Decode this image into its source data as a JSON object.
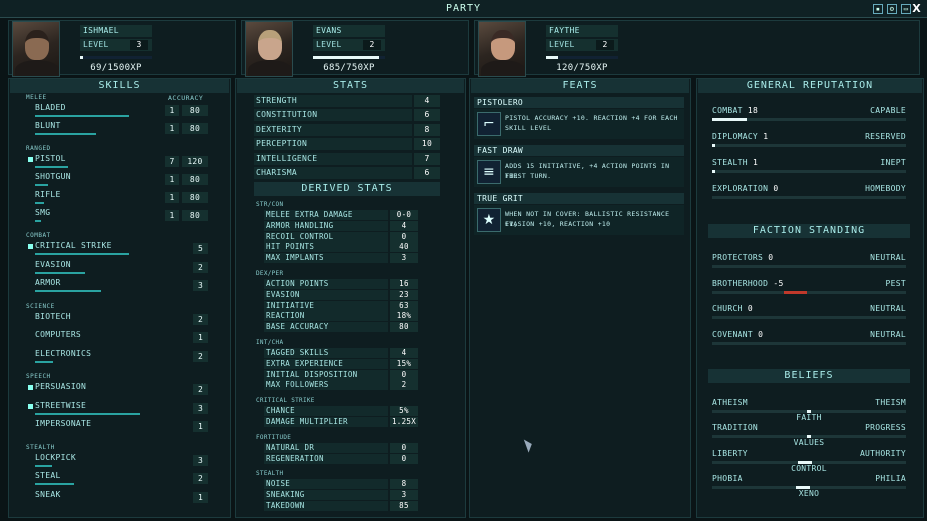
{
  "window": {
    "title": "PARTY",
    "close": "X"
  },
  "party": [
    {
      "name": "ISHMAEL",
      "level_label": "LEVEL",
      "level": "3",
      "xp": "69/1500XP",
      "xp_progress": 0.046,
      "skin": "#8a6a52",
      "hair": "#2a211c"
    },
    {
      "name": "EVANS",
      "level_label": "LEVEL",
      "level": "2",
      "xp": "685/750XP",
      "xp_progress": 0.913,
      "skin": "#c9a58c",
      "hair": "#b8a07a"
    },
    {
      "name": "FAYTHE",
      "level_label": "LEVEL",
      "level": "2",
      "xp": "120/750XP",
      "xp_progress": 0.16,
      "skin": "#c6997d",
      "hair": "#3a2a25"
    }
  ],
  "skills": {
    "title": "SKILLS",
    "accuracy_label": "ACCURACY",
    "sections": [
      {
        "name": "MELEE",
        "items": [
          {
            "name": "BLADED",
            "value": "1",
            "accuracy": "80",
            "bar": 0.85,
            "tag": false
          },
          {
            "name": "BLUNT",
            "value": "1",
            "accuracy": "80",
            "bar": 0.55,
            "tag": false
          }
        ]
      },
      {
        "name": "RANGED",
        "items": [
          {
            "name": "PISTOL",
            "value": "7",
            "accuracy": "120",
            "bar": 0.3,
            "tag": true
          },
          {
            "name": "SHOTGUN",
            "value": "1",
            "accuracy": "80",
            "bar": 0.12,
            "tag": false
          },
          {
            "name": "RIFLE",
            "value": "1",
            "accuracy": "80",
            "bar": 0.08,
            "tag": false
          },
          {
            "name": "SMG",
            "value": "1",
            "accuracy": "80",
            "bar": 0.05,
            "tag": false
          }
        ]
      },
      {
        "name": "COMBAT",
        "items": [
          {
            "name": "CRITICAL STRIKE",
            "value": "5",
            "bar": 0.85,
            "tag": true
          },
          {
            "name": "EVASION",
            "value": "2",
            "bar": 0.45,
            "tag": false
          },
          {
            "name": "ARMOR",
            "value": "3",
            "bar": 0.6,
            "tag": false
          }
        ]
      },
      {
        "name": "SCIENCE",
        "items": [
          {
            "name": "BIOTECH",
            "value": "2",
            "bar": 0.0,
            "tag": false
          },
          {
            "name": "COMPUTERS",
            "value": "1",
            "bar": 0.0,
            "tag": false
          },
          {
            "name": "ELECTRONICS",
            "value": "2",
            "bar": 0.16,
            "tag": false
          }
        ]
      },
      {
        "name": "SPEECH",
        "items": [
          {
            "name": "PERSUASION",
            "value": "2",
            "bar": 0.0,
            "tag": true
          },
          {
            "name": "STREETWISE",
            "value": "3",
            "bar": 0.95,
            "tag": true
          },
          {
            "name": "IMPERSONATE",
            "value": "1",
            "bar": 0.0,
            "tag": false
          }
        ]
      },
      {
        "name": "STEALTH",
        "items": [
          {
            "name": "LOCKPICK",
            "value": "3",
            "bar": 0.15,
            "tag": false
          },
          {
            "name": "STEAL",
            "value": "2",
            "bar": 0.35,
            "tag": false
          },
          {
            "name": "SNEAK",
            "value": "1",
            "bar": 0.0,
            "tag": false
          }
        ]
      }
    ]
  },
  "stats": {
    "title": "STATS",
    "items": [
      {
        "name": "STRENGTH",
        "value": "4"
      },
      {
        "name": "CONSTITUTION",
        "value": "6"
      },
      {
        "name": "DEXTERITY",
        "value": "8"
      },
      {
        "name": "PERCEPTION",
        "value": "10"
      },
      {
        "name": "INTELLIGENCE",
        "value": "7"
      },
      {
        "name": "CHARISMA",
        "value": "6"
      }
    ]
  },
  "derived": {
    "title": "DERIVED STATS",
    "sections": [
      {
        "name": "STR/CON",
        "items": [
          {
            "name": "MELEE EXTRA DAMAGE",
            "value": "0-0"
          },
          {
            "name": "ARMOR HANDLING",
            "value": "4"
          },
          {
            "name": "RECOIL CONTROL",
            "value": "0"
          },
          {
            "name": "HIT POINTS",
            "value": "40"
          },
          {
            "name": "MAX IMPLANTS",
            "value": "3"
          }
        ]
      },
      {
        "name": "DEX/PER",
        "items": [
          {
            "name": "ACTION POINTS",
            "value": "16"
          },
          {
            "name": "EVASION",
            "value": "23"
          },
          {
            "name": "INITIATIVE",
            "value": "63"
          },
          {
            "name": "REACTION",
            "value": "18%"
          },
          {
            "name": "BASE ACCURACY",
            "value": "80"
          }
        ]
      },
      {
        "name": "INT/CHA",
        "items": [
          {
            "name": "TAGGED SKILLS",
            "value": "4"
          },
          {
            "name": "EXTRA EXPERIENCE",
            "value": "15%"
          },
          {
            "name": "INITIAL DISPOSITION",
            "value": "0"
          },
          {
            "name": "MAX FOLLOWERS",
            "value": "2"
          }
        ]
      },
      {
        "name": "CRITICAL STRIKE",
        "items": [
          {
            "name": "CHANCE",
            "value": "5%"
          },
          {
            "name": "DAMAGE MULTIPLIER",
            "value": "1.25x"
          }
        ]
      },
      {
        "name": "FORTITUDE",
        "items": [
          {
            "name": "NATURAL DR",
            "value": "0"
          },
          {
            "name": "REGENERATION",
            "value": "0"
          }
        ]
      },
      {
        "name": "STEALTH",
        "items": [
          {
            "name": "NOISE",
            "value": "8"
          },
          {
            "name": "SNEAKING",
            "value": "3"
          },
          {
            "name": "TAKEDOWN",
            "value": "85"
          }
        ]
      }
    ]
  },
  "feats": {
    "title": "FEATS",
    "items": [
      {
        "name": "PISTOLERO",
        "icon": "pistol-icon",
        "glyph": "⌐",
        "desc1": "PISTOL ACCURACY +10. REACTION +4 FOR EACH",
        "desc2": "SKILL LEVEL"
      },
      {
        "name": "FAST DRAW",
        "icon": "hand-icon",
        "glyph": "≡",
        "desc1": "ADDS 15 INITIATIVE, +4 ACTION POINTS IN THE",
        "desc2": "FIRST TURN."
      },
      {
        "name": "TRUE GRIT",
        "icon": "star-icon",
        "glyph": "★",
        "desc1": "WHEN NOT IN COVER: BALLISTIC RESISTANCE +1,",
        "desc2": "EVASION +10, REACTION +10"
      }
    ]
  },
  "reputation": {
    "title": "GENERAL REPUTATION",
    "items": [
      {
        "name": "COMBAT",
        "value": "18",
        "rank": "CAPABLE",
        "fill": 0.18,
        "negative": false
      },
      {
        "name": "DIPLOMACY",
        "value": "1",
        "rank": "RESERVED",
        "fill": 0.01,
        "negative": false
      },
      {
        "name": "STEALTH",
        "value": "1",
        "rank": "INEPT",
        "fill": 0.01,
        "negative": false
      },
      {
        "name": "EXPLORATION",
        "value": "0",
        "rank": "HOMEBODY",
        "fill": 0.0,
        "negative": false
      }
    ]
  },
  "factions": {
    "title": "FACTION STANDING",
    "items": [
      {
        "name": "PROTECTORS",
        "value": "0",
        "rank": "NEUTRAL",
        "fill": 0.0,
        "negative": false
      },
      {
        "name": "BROTHERHOOD",
        "value": "-5",
        "rank": "PEST",
        "fill": 0.12,
        "negative": true
      },
      {
        "name": "CHURCH",
        "value": "0",
        "rank": "NEUTRAL",
        "fill": 0.0,
        "negative": false
      },
      {
        "name": "COVENANT",
        "value": "0",
        "rank": "NEUTRAL",
        "fill": 0.0,
        "negative": false
      }
    ]
  },
  "beliefs": {
    "title": "BELIEFS",
    "items": [
      {
        "left": "ATHEISM",
        "right": "THEISM",
        "center": "FAITH",
        "pos": 0.5,
        "wide": false
      },
      {
        "left": "TRADITION",
        "right": "PROGRESS",
        "center": "VALUES",
        "pos": 0.5,
        "wide": false
      },
      {
        "left": "LIBERTY",
        "right": "AUTHORITY",
        "center": "CONTROL",
        "pos": 0.48,
        "wide": true
      },
      {
        "left": "PHOBIA",
        "right": "PHILIA",
        "center": "XENO",
        "pos": 0.47,
        "wide": true
      }
    ]
  },
  "colors": {
    "accent": "#2aa3a1",
    "negative": "#c0392b",
    "panel": "#0e1d20"
  }
}
